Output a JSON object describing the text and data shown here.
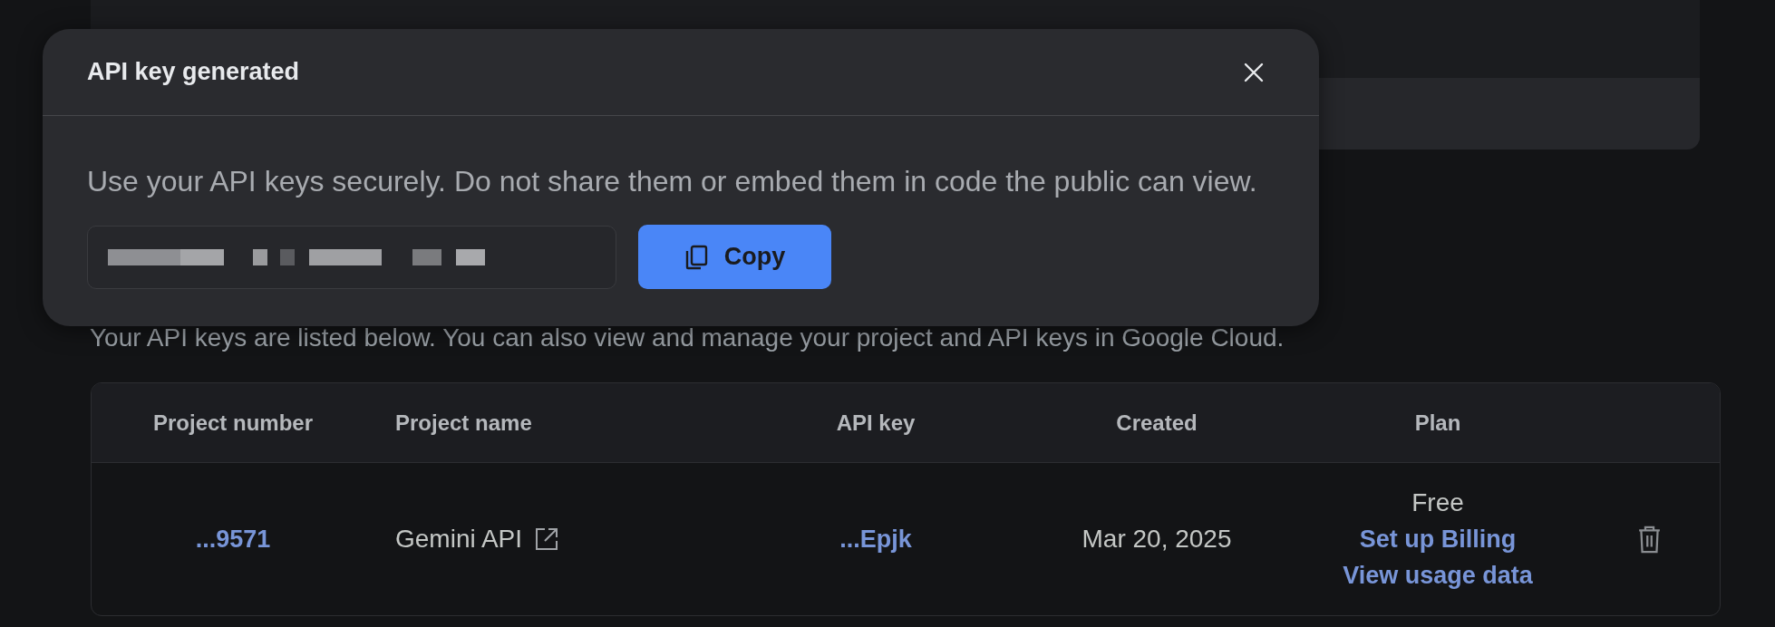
{
  "dialog": {
    "title": "API key generated",
    "description": "Use your API keys securely. Do not share them or embed them in code the public can view.",
    "key_field": {
      "redacted": true
    },
    "copy_button": "Copy"
  },
  "intro": "Your API keys are listed below. You can also view and manage your project and API keys in Google Cloud.",
  "table": {
    "columns": [
      "Project number",
      "Project name",
      "API key",
      "Created",
      "Plan"
    ],
    "rows": [
      {
        "project_number": "...9571",
        "project_name": "Gemini API",
        "api_key": "...Epjk",
        "created": "Mar 20, 2025",
        "plan": "Free",
        "plan_links": [
          "Set up Billing",
          "View usage data"
        ]
      }
    ]
  }
}
